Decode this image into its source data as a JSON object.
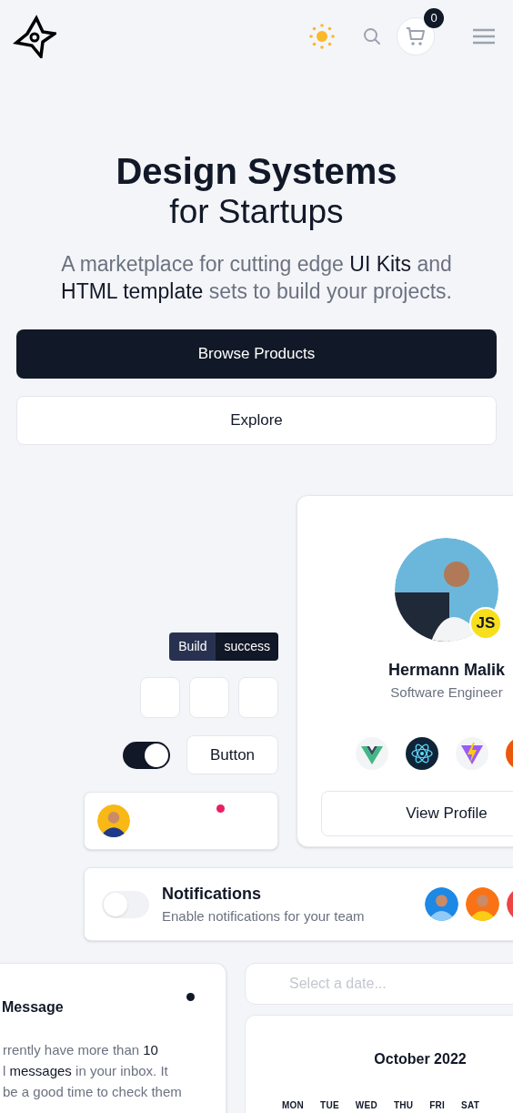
{
  "header": {
    "cart_count": "0"
  },
  "hero": {
    "title": "Design Systems",
    "subtitle": "for Startups",
    "description": "A marketplace for cutting edge **UI Kits** and **HTML template** sets to build your projects.",
    "buttons": [
      {
        "label": "Browse Products",
        "kind": "primary"
      },
      {
        "label": "Explore",
        "kind": "secondary"
      }
    ]
  },
  "build_badge": {
    "label": "Build",
    "status": "success"
  },
  "toggle": {
    "on": true
  },
  "button": {
    "label": "Button"
  },
  "avatar_card": {
    "notification": true
  },
  "profile": {
    "name": "Hermann Malik",
    "role": "Software Engineer",
    "badge": "JS",
    "button": "View Profile"
  },
  "notifications": {
    "title": "Notifications",
    "description": "Enable notifications for your team",
    "on": false
  },
  "message": {
    "title": "Message",
    "unread": true,
    "lines": [
      "rrently have more than **10**",
      "l **messages** in your inbox. It",
      "be a good time to check them"
    ]
  },
  "date_field": {
    "placeholder": "Select a date..."
  },
  "calendar": {
    "month": "October 2022",
    "weekdays": [
      "MON",
      "TUE",
      "WED",
      "THU",
      "FRI",
      "SAT"
    ]
  }
}
